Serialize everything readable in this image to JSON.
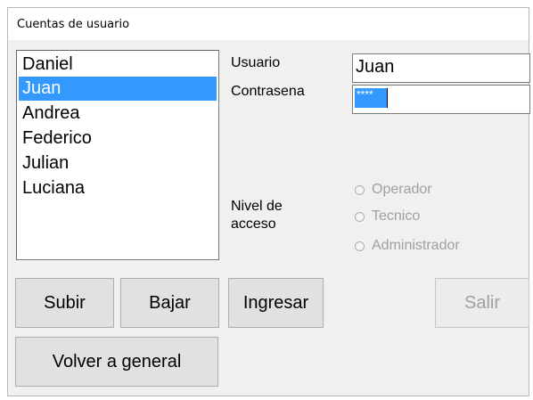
{
  "window": {
    "title": "Cuentas de usuario"
  },
  "users": {
    "items": [
      "Daniel",
      "Juan",
      "Andrea",
      "Federico",
      "Julian",
      "Luciana"
    ],
    "selected": "Juan"
  },
  "form": {
    "usuario_label": "Usuario",
    "usuario_value": "Juan",
    "contrasena_label": "Contrasena",
    "contrasena_value": "****",
    "nivel_label_line1": "Nivel de",
    "nivel_label_line2": "acceso",
    "nivel_options": [
      "Operador",
      "Tecnico",
      "Administrador"
    ]
  },
  "buttons": {
    "subir": "Subir",
    "bajar": "Bajar",
    "ingresar": "Ingresar",
    "salir": "Salir",
    "volver": "Volver a general"
  },
  "colors": {
    "selection": "#3399ff",
    "disabled_text": "#a0a0a0"
  }
}
